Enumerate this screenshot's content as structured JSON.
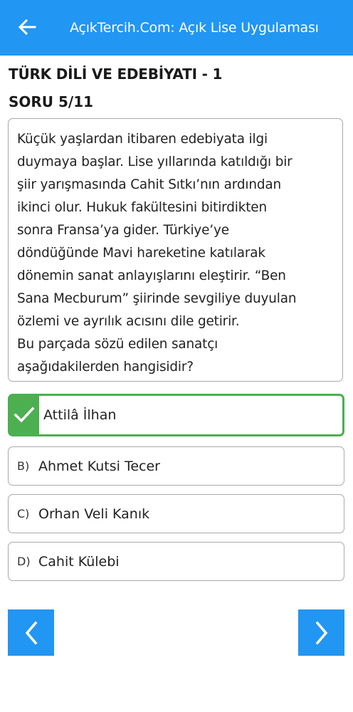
{
  "app": {
    "title": "AçıkTercih.Com: Açık Lise Uygulaması",
    "accent_color": "#2196f3",
    "back_icon": "arrow-left-icon"
  },
  "quiz": {
    "subject": "TÜRK DİLİ VE EDEBİYATI - 1",
    "counter": "SORU 5/11",
    "question": "Küçük yaşlardan itibaren edebiyata ilgi\nduymaya başlar. Lise yıllarında katıldığı bir\nşiir yarışmasında Cahit Sıtkı’nın ardından\nikinci olur. Hukuk fakültesini bitirdikten\nsonra Fransa’ya gider. Türkiye’ye\ndöndüğünde Mavi hareketine katılarak\ndönemin sanat anlayışlarını eleştirir. “Ben\nSana Mecburum” şiirinde sevgiliye duyulan\nözlemi ve ayrılık acısını dile getirir.\nBu parçada sözü edilen sanatçı\naşağıdakilerden hangisidir?",
    "options": [
      {
        "letter": "",
        "text": "Attilâ İlhan",
        "state": "correct",
        "icon": "check-icon"
      },
      {
        "letter": "B)",
        "text": "Ahmet Kutsi Tecer",
        "state": "normal"
      },
      {
        "letter": "C)",
        "text": "Orhan Veli Kanık",
        "state": "normal"
      },
      {
        "letter": "D)",
        "text": "Cahit Külebi",
        "state": "normal"
      }
    ],
    "correct_color": "#4caf50"
  },
  "navigation": {
    "prev_icon": "chevron-left-icon",
    "next_icon": "chevron-right-icon"
  }
}
